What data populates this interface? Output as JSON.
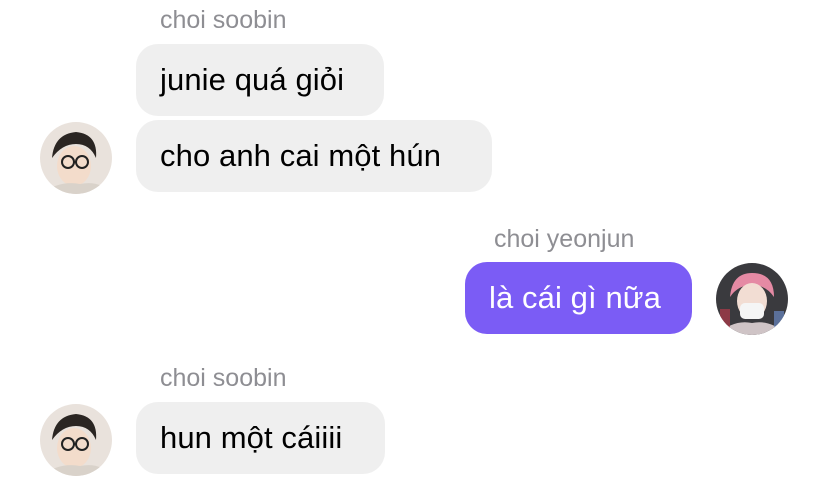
{
  "messages": [
    {
      "sender": "choi soobin",
      "side": "incoming",
      "texts": [
        "junie quá giỏi",
        "cho anh cai một hún"
      ]
    },
    {
      "sender": "choi yeonjun",
      "side": "outgoing",
      "texts": [
        "là cái gì nữa"
      ]
    },
    {
      "sender": "choi soobin",
      "side": "incoming",
      "texts": [
        "hun một cáiiii"
      ]
    }
  ],
  "colors": {
    "incoming_bubble": "#efefef",
    "outgoing_bubble": "#7b5cf5",
    "sender_name": "#8e8e93"
  }
}
